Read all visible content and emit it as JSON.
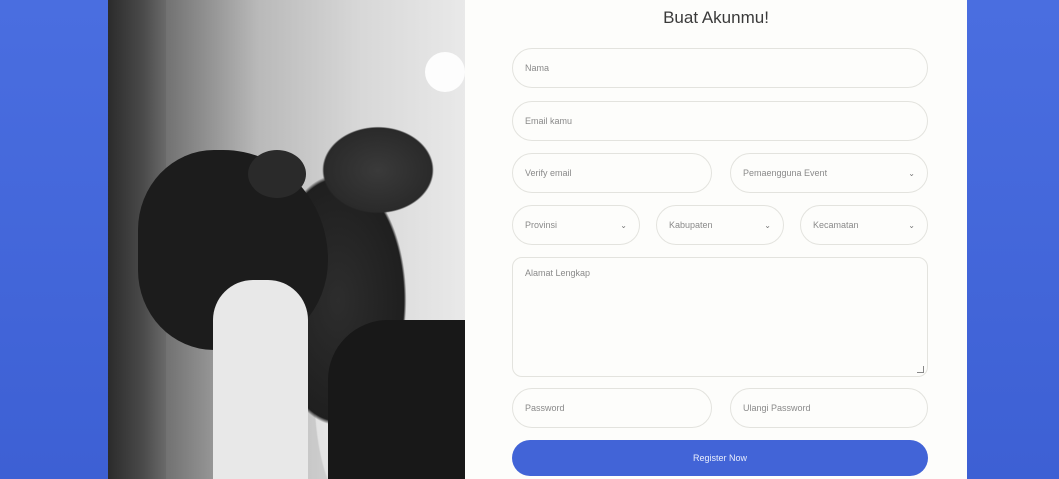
{
  "form": {
    "title": "Buat Akunmu!",
    "name_placeholder": "Nama",
    "email_placeholder": "Email kamu",
    "verify_email_placeholder": "Verify email",
    "gender_select": "Pemaengguna Event",
    "province_select": "Provinsi",
    "regency_select": "Kabupaten",
    "district_select": "Kecamatan",
    "address_placeholder": "Alamat Lengkap",
    "password_placeholder": "Password",
    "repeat_password_placeholder": "Ulangi Password",
    "register_label": "Register Now"
  },
  "colors": {
    "accent": "#4264d7",
    "background": "#3f63d6"
  }
}
